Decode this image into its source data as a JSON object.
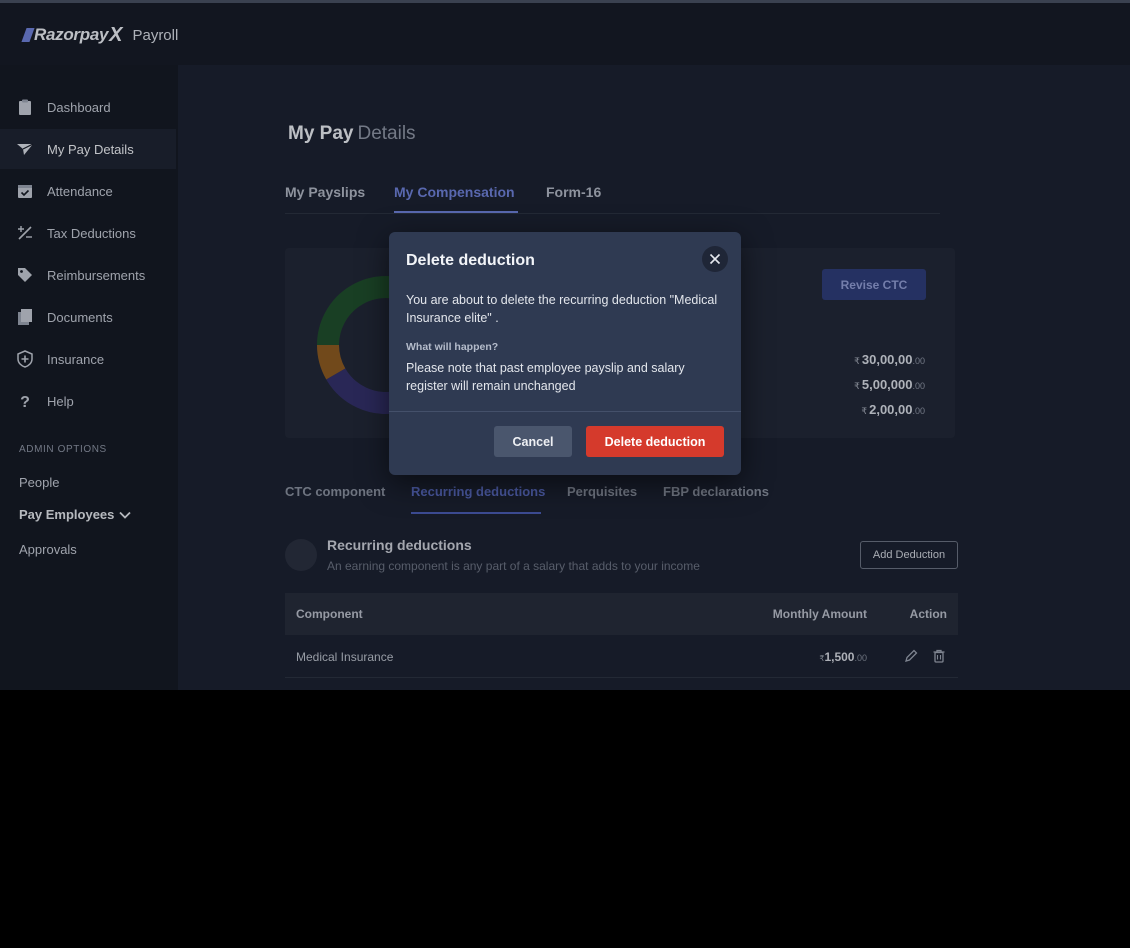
{
  "brand": {
    "name": "Razorpay",
    "mark": "X",
    "product": "Payroll"
  },
  "sidebar": {
    "items": [
      {
        "label": "Dashboard",
        "icon": "clipboard-icon"
      },
      {
        "label": "My Pay Details",
        "icon": "send-icon",
        "active": true
      },
      {
        "label": "Attendance",
        "icon": "calendar-check-icon"
      },
      {
        "label": "Tax Deductions",
        "icon": "percent-icon"
      },
      {
        "label": "Reimbursements",
        "icon": "tag-icon"
      },
      {
        "label": "Documents",
        "icon": "document-icon"
      },
      {
        "label": "Insurance",
        "icon": "shield-plus-icon"
      },
      {
        "label": "Help",
        "icon": "question-icon"
      }
    ],
    "admin_heading": "ADMIN OPTIONS",
    "admin_items": [
      {
        "label": "People"
      },
      {
        "label": "Pay Employees",
        "expandable": true
      },
      {
        "label": "Approvals"
      }
    ]
  },
  "main": {
    "title_strong": "My Pay",
    "title_light": "Details",
    "tabs": [
      {
        "label": "My Payslips"
      },
      {
        "label": "My Compensation",
        "active": true
      },
      {
        "label": "Form-16"
      }
    ],
    "ctc_card": {
      "revise_label": "Revise CTC",
      "currency": "₹",
      "amounts": [
        {
          "whole": "30,00,00",
          "decimal": ".00"
        },
        {
          "whole": "5,00,000",
          "decimal": ".00"
        },
        {
          "whole": "2,00,00",
          "decimal": ".00"
        }
      ]
    },
    "sub_tabs": [
      {
        "label": "CTC component"
      },
      {
        "label": "Recurring deductions",
        "active": true
      },
      {
        "label": "Perquisites"
      },
      {
        "label": "FBP declarations"
      }
    ],
    "section": {
      "title": "Recurring deductions",
      "description": "An earning component is any part of a salary that adds to your income",
      "add_label": "Add Deduction"
    },
    "table": {
      "columns": [
        "Component",
        "Monthly Amount",
        "Action"
      ],
      "rows": [
        {
          "component": "Medical Insurance",
          "amount_whole": "1,500",
          "amount_decimal": ".00"
        }
      ]
    }
  },
  "modal": {
    "title": "Delete deduction",
    "body": "You are about to delete the recurring deduction \"Medical Insurance elite\" .",
    "question": "What will happen?",
    "note": "Please note that past employee payslip and salary register will remain unchanged",
    "cancel_label": "Cancel",
    "confirm_label": "Delete deduction"
  },
  "colors": {
    "accent": "#6d7fd6",
    "danger": "#d53a2c",
    "donut_green": "#1f4d2c",
    "donut_orange": "#8a5a22",
    "donut_purple": "#33306a"
  }
}
